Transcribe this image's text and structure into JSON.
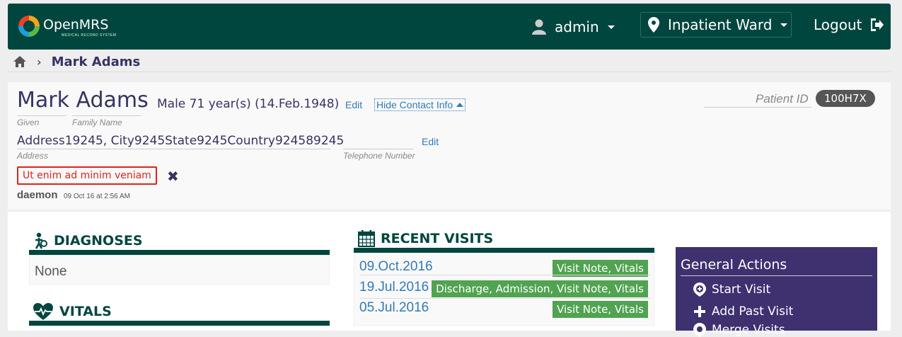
{
  "header": {
    "app_name": "OpenMRS",
    "app_sub": "MEDICAL RECORD SYSTEM",
    "user": "admin",
    "location": "Inpatient Ward",
    "logout": "Logout"
  },
  "breadcrumb": {
    "current": "Mark Adams"
  },
  "patient": {
    "name": "Mark Adams",
    "given_label": "Given",
    "family_label": "Family Name",
    "demographics": "Male  71 year(s) (14.Feb.1948)",
    "edit_label": "Edit",
    "hide_contact": "Hide Contact Info",
    "patient_id_label": "Patient ID",
    "patient_id": "100H7X",
    "address": "Address19245, City9245State9245Country924589245",
    "address_label": "Address",
    "telephone_label": "Telephone Number",
    "alert": "Ut enim ad minim veniam",
    "alert_author": "daemon",
    "alert_date": "09 Oct 16 at 2:56 AM"
  },
  "diagnoses": {
    "title": "DIAGNOSES",
    "empty": "None"
  },
  "vitals": {
    "title": "VITALS"
  },
  "recent_visits": {
    "title": "RECENT VISITS",
    "items": [
      {
        "date": "09.Oct.2016",
        "tags": "Visit Note, Vitals"
      },
      {
        "date": "19.Jul.2016",
        "tags": "Discharge, Admission, Visit Note, Vitals"
      },
      {
        "date": "05.Jul.2016",
        "tags": "Visit Note, Vitals"
      }
    ]
  },
  "general_actions": {
    "title": "General Actions",
    "items": [
      "Start Visit",
      "Add Past Visit",
      "Merge Visits"
    ]
  }
}
